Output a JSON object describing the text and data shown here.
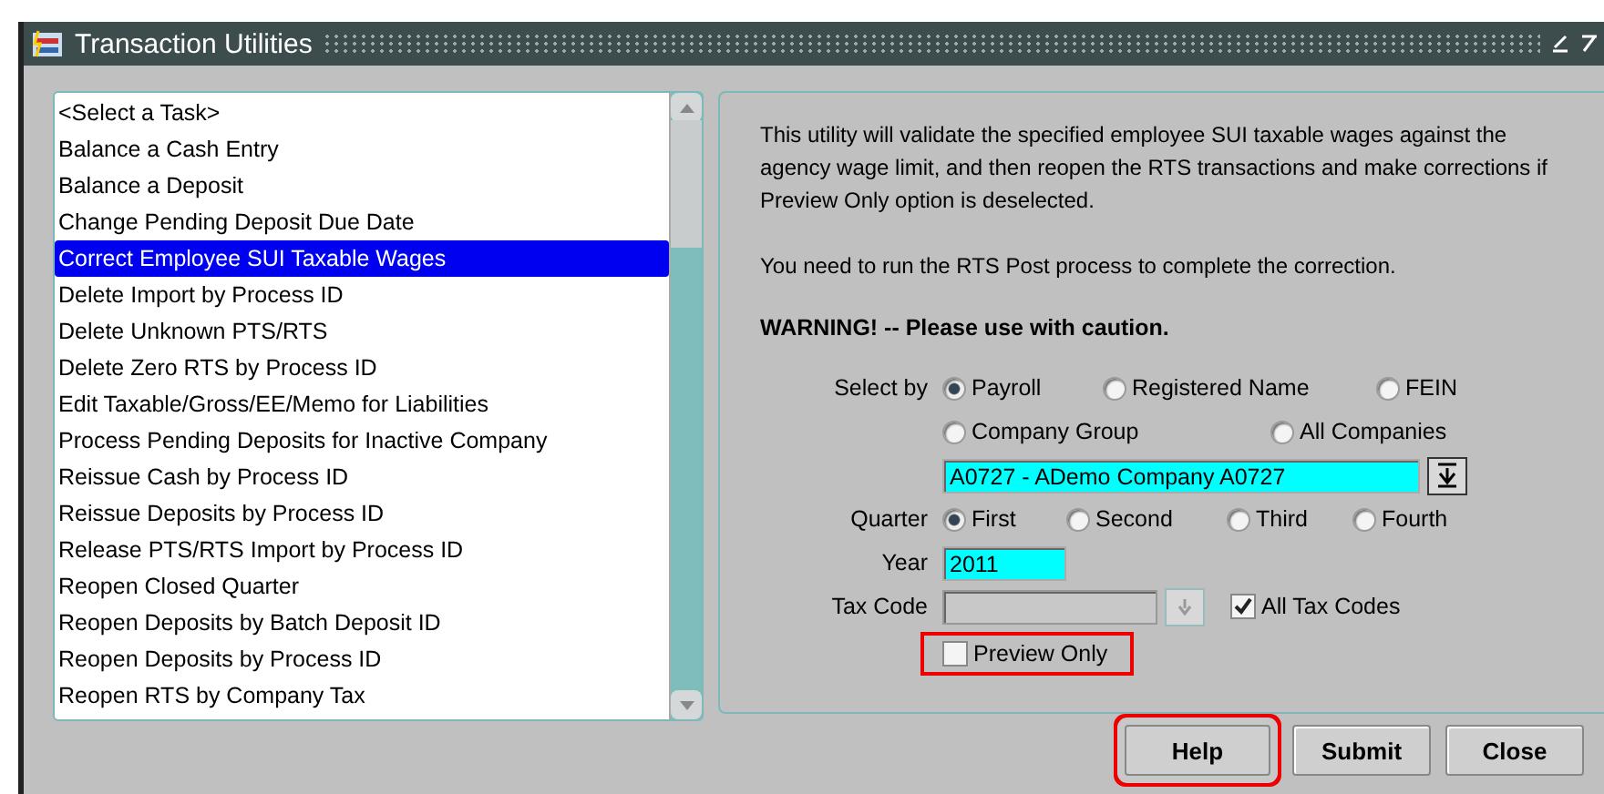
{
  "window": {
    "title": "Transaction Utilities"
  },
  "task_list": {
    "items": [
      {
        "label": "<Select a Task>",
        "selected": false
      },
      {
        "label": "Balance a Cash Entry",
        "selected": false
      },
      {
        "label": "Balance a Deposit",
        "selected": false
      },
      {
        "label": "Change Pending Deposit Due Date",
        "selected": false
      },
      {
        "label": "Correct Employee SUI Taxable Wages",
        "selected": true
      },
      {
        "label": "Delete Import by Process ID",
        "selected": false
      },
      {
        "label": "Delete Unknown PTS/RTS",
        "selected": false
      },
      {
        "label": "Delete Zero RTS by Process ID",
        "selected": false
      },
      {
        "label": "Edit Taxable/Gross/EE/Memo for Liabilities",
        "selected": false
      },
      {
        "label": "Process Pending Deposits for Inactive Company",
        "selected": false
      },
      {
        "label": "Reissue Cash by Process ID",
        "selected": false
      },
      {
        "label": "Reissue Deposits by Process ID",
        "selected": false
      },
      {
        "label": "Release PTS/RTS Import by Process ID",
        "selected": false
      },
      {
        "label": "Reopen Closed Quarter",
        "selected": false
      },
      {
        "label": "Reopen Deposits by Batch Deposit ID",
        "selected": false
      },
      {
        "label": "Reopen Deposits by Process ID",
        "selected": false
      },
      {
        "label": "Reopen RTS by Company Tax",
        "selected": false
      }
    ]
  },
  "details": {
    "description": "This utility will validate the specified employee SUI taxable wages against the agency wage limit, and then reopen the RTS transactions and make corrections if Preview Only option is deselected.",
    "note": "You need to run the RTS Post process to complete the correction.",
    "warning": "WARNING! -- Please use with caution.",
    "select_by": {
      "label": "Select by",
      "options": [
        {
          "label": "Payroll",
          "selected": true
        },
        {
          "label": "Registered Name",
          "selected": false
        },
        {
          "label": "FEIN",
          "selected": false
        },
        {
          "label": "Company Group",
          "selected": false
        },
        {
          "label": "All Companies",
          "selected": false
        }
      ]
    },
    "company": {
      "value": "A0727 - ADemo Company A0727"
    },
    "quarter": {
      "label": "Quarter",
      "options": [
        {
          "label": "First",
          "selected": true
        },
        {
          "label": "Second",
          "selected": false
        },
        {
          "label": "Third",
          "selected": false
        },
        {
          "label": "Fourth",
          "selected": false
        }
      ]
    },
    "year": {
      "label": "Year",
      "value": "2011"
    },
    "tax_code": {
      "label": "Tax Code",
      "disabled": true
    },
    "all_tax_codes": {
      "label": "All Tax Codes",
      "checked": true
    },
    "preview_only": {
      "label": "Preview Only",
      "checked": false,
      "highlighted": true
    }
  },
  "buttons": [
    {
      "label": "Help",
      "highlighted": true
    },
    {
      "label": "Submit",
      "highlighted": false
    },
    {
      "label": "Close",
      "highlighted": false
    }
  ]
}
